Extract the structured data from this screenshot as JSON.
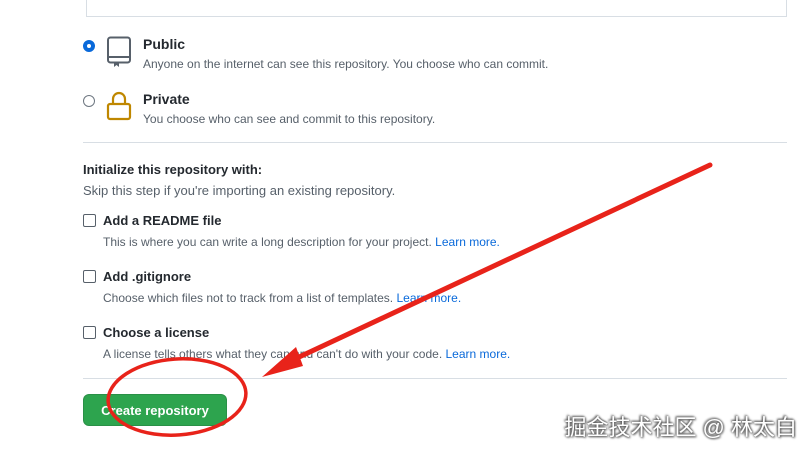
{
  "visibility": {
    "public": {
      "label": "Public",
      "description": "Anyone on the internet can see this repository. You choose who can commit.",
      "icon": "repo-icon",
      "selected": true
    },
    "private": {
      "label": "Private",
      "description": "You choose who can see and commit to this repository.",
      "icon": "lock-icon",
      "selected": false
    }
  },
  "initialize": {
    "heading": "Initialize this repository with:",
    "subheading": "Skip this step if you're importing an existing repository.",
    "readme": {
      "label": "Add a README file",
      "description": "This is where you can write a long description for your project.",
      "link": "Learn more.",
      "checked": false
    },
    "gitignore": {
      "label": "Add .gitignore",
      "description": "Choose which files not to track from a list of templates.",
      "link": "Learn more.",
      "checked": false
    },
    "license": {
      "label": "Choose a license",
      "description": "A license tells others what they can and can't do with your code.",
      "link": "Learn more.",
      "checked": false
    }
  },
  "actions": {
    "create_label": "Create repository"
  },
  "watermark": "掘金技术社区 @ 林太白",
  "colors": {
    "primary_button": "#2da44e",
    "link": "#0969da",
    "annotation": "#e8231a",
    "radio_selected": "#0969da"
  }
}
